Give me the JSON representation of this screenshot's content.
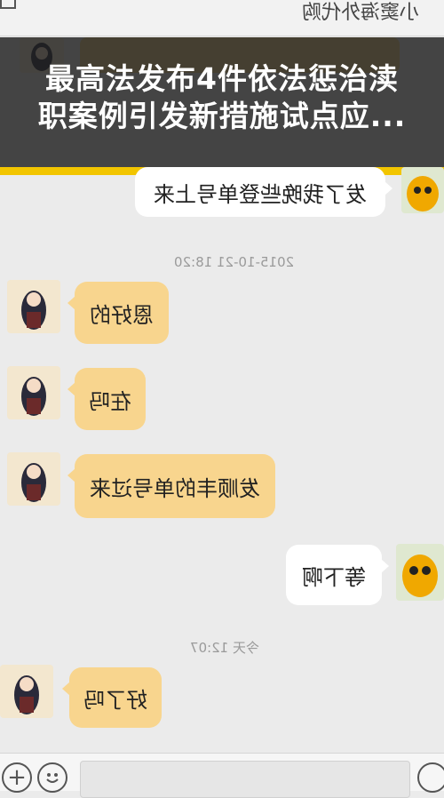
{
  "header": {
    "title": "小窦海外代购"
  },
  "banner": {
    "line1": "最高法发布4件依法惩治渎",
    "line2": "职案例引发新措施试点应..."
  },
  "messages": [
    {
      "side": "right",
      "text": "发了我晚些登单号上来"
    },
    {
      "side": "time",
      "text": "2015-10-21 18:20"
    },
    {
      "side": "left",
      "text": "恩好的"
    },
    {
      "side": "left",
      "text": "在吗"
    },
    {
      "side": "left",
      "text": "发顺丰的单号过来"
    },
    {
      "side": "right",
      "text": "等下啊"
    },
    {
      "side": "time",
      "text": "今天 12:07"
    },
    {
      "side": "left",
      "text": "好了吗"
    }
  ],
  "icons": {
    "add": "plus-circle-icon",
    "emoji": "smiley-face-icon",
    "back": "back-icon"
  },
  "colors": {
    "banner_accent": "#f2c500",
    "bubble_received": "#f8d58e",
    "bubble_sent": "#ffffff"
  }
}
